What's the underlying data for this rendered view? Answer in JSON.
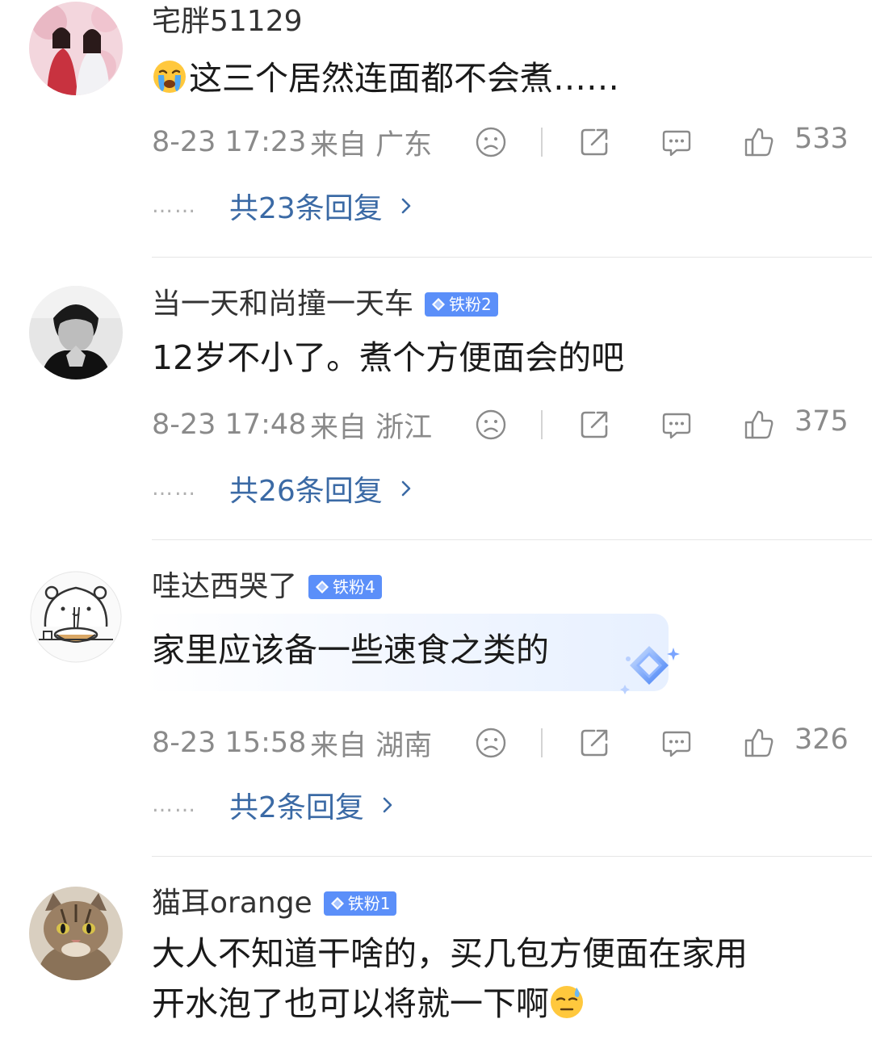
{
  "comments": [
    {
      "username": "宅胖51129",
      "badge": "",
      "emoji_prefix": "crying-emoji",
      "content": "这三个居然连面都不会煮……",
      "time": "8-23 17:23",
      "location": "来自 广东",
      "likes": "533",
      "dots": "……",
      "replies": "共23条回复"
    },
    {
      "username": "当一天和尚撞一天车",
      "badge": "铁粉2",
      "content": "12岁不小了。煮个方便面会的吧",
      "time": "8-23 17:48",
      "location": "来自 浙江",
      "likes": "375",
      "dots": "……",
      "replies": "共26条回复"
    },
    {
      "username": "哇达西哭了",
      "badge": "铁粉4",
      "content": "家里应该备一些速食之类的",
      "time": "8-23 15:58",
      "location": "来自 湖南",
      "likes": "326",
      "dots": "……",
      "replies": "共2条回复"
    },
    {
      "username": "猫耳orange",
      "badge": "铁粉1",
      "content_line1": "大人不知道干啥的，买几包方便面在家用",
      "content_line2": "开水泡了也可以将就一下啊",
      "emoji_suffix": "sweat-emoji"
    }
  ],
  "colors": {
    "badge": "#5b8ff9",
    "reply_link": "#3b6aa5",
    "meta_gray": "#8a8a8a"
  },
  "icons": [
    "sad-face-icon",
    "share-icon",
    "comment-icon",
    "thumbs-up-icon",
    "chevron-right-icon",
    "diamond-icon"
  ]
}
